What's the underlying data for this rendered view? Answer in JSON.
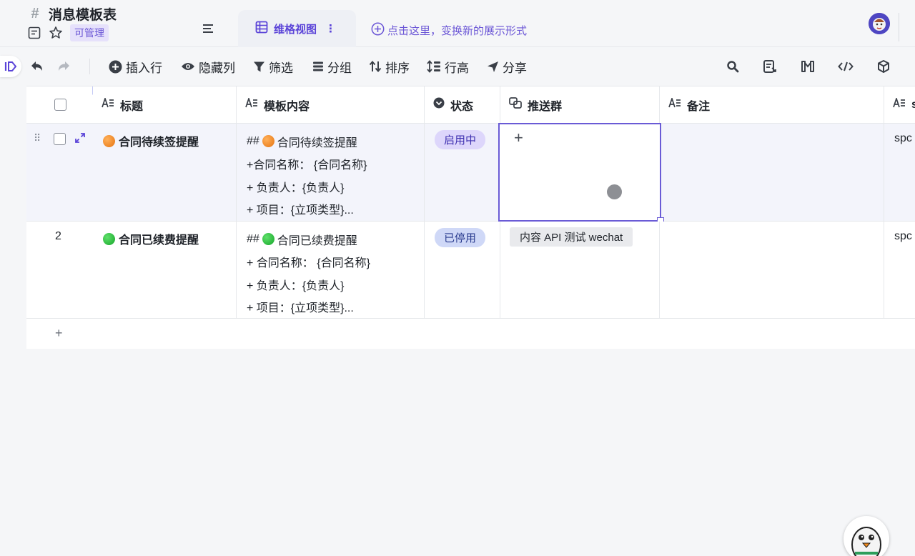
{
  "header": {
    "doc_title": "消息模板表",
    "permission": "可管理",
    "view_tab_label": "维格视图",
    "add_view_label": "点击这里，变换新的展示形式"
  },
  "toolbar": {
    "insert_row": "插入行",
    "hide_columns": "隐藏列",
    "filter": "筛选",
    "group": "分组",
    "sort": "排序",
    "row_height": "行高",
    "share": "分享"
  },
  "table": {
    "columns": [
      "标题",
      "模板内容",
      "状态",
      "推送群",
      "备注",
      "s"
    ],
    "rows": [
      {
        "title": "合同待续签提醒",
        "content": [
          "## 🟠 合同待续签提醒",
          "+合同名称： {合同名称}",
          "+ 负责人：{负责人}",
          "+ 项目：{立项类型}..."
        ],
        "content_head": "合同待续签提醒",
        "status": "启用中",
        "push_group": "",
        "note": "",
        "extra": "spc"
      },
      {
        "row_number": "2",
        "title": "合同已续费提醒",
        "content": [
          "## 🟢 合同已续费提醒",
          "+ 合同名称： {合同名称}",
          "+ 负责人：{负责人}",
          "+ 项目：{立项类型}..."
        ],
        "content_head": "合同已续费提醒",
        "status": "已停用",
        "push_group": "内容 API 测试 wechat",
        "note": "",
        "extra": "spc"
      }
    ],
    "add_row_symbol": "+",
    "cell_add_symbol": "+"
  },
  "colors": {
    "accent": "#5b44d8",
    "status_on_bg": "#ddd6fb",
    "status_off_bg": "#cfd8f7"
  }
}
